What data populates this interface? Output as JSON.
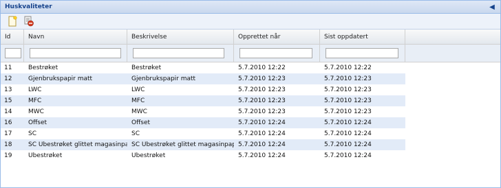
{
  "panel": {
    "title": "Huskvaliteter"
  },
  "toolbar": {
    "add_icon": "new-document-icon",
    "delete_icon": "delete-icon"
  },
  "columns": [
    "Id",
    "Navn",
    "Beskrivelse",
    "Opprettet når",
    "Sist oppdatert"
  ],
  "filters": {
    "id": "",
    "navn": "",
    "beskrivelse": "",
    "opprettet": "",
    "sist": ""
  },
  "rows": [
    {
      "id": "11",
      "navn": "Bestrøket",
      "beskrivelse": "Bestrøket",
      "opprettet": "5.7.2010 12:22",
      "sist": "5.7.2010 12:22"
    },
    {
      "id": "12",
      "navn": "Gjenbrukspapir matt",
      "beskrivelse": "Gjenbrukspapir matt",
      "opprettet": "5.7.2010 12:23",
      "sist": "5.7.2010 12:23"
    },
    {
      "id": "13",
      "navn": "LWC",
      "beskrivelse": "LWC",
      "opprettet": "5.7.2010 12:23",
      "sist": "5.7.2010 12:23"
    },
    {
      "id": "15",
      "navn": "MFC",
      "beskrivelse": "MFC",
      "opprettet": "5.7.2010 12:23",
      "sist": "5.7.2010 12:23"
    },
    {
      "id": "14",
      "navn": "MWC",
      "beskrivelse": "MWC",
      "opprettet": "5.7.2010 12:23",
      "sist": "5.7.2010 12:23"
    },
    {
      "id": "16",
      "navn": "Offset",
      "beskrivelse": "Offset",
      "opprettet": "5.7.2010 12:24",
      "sist": "5.7.2010 12:24"
    },
    {
      "id": "17",
      "navn": "SC",
      "beskrivelse": "SC",
      "opprettet": "5.7.2010 12:24",
      "sist": "5.7.2010 12:24"
    },
    {
      "id": "18",
      "navn": "SC Ubestrøket glittet magasinpapir",
      "beskrivelse": "SC Ubestrøket glittet magasinpapir",
      "opprettet": "5.7.2010 12:24",
      "sist": "5.7.2010 12:24"
    },
    {
      "id": "19",
      "navn": "Ubestrøket",
      "beskrivelse": "Ubestrøket",
      "opprettet": "5.7.2010 12:24",
      "sist": "5.7.2010 12:24"
    }
  ]
}
